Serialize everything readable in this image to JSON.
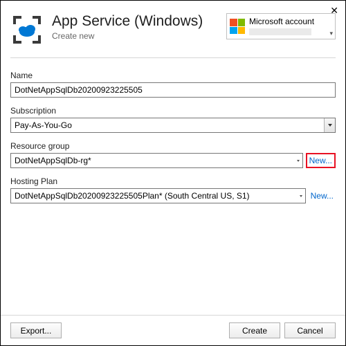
{
  "header": {
    "title": "App Service (Windows)",
    "subtitle": "Create new",
    "account_label": "Microsoft account"
  },
  "fields": {
    "name": {
      "label": "Name",
      "value": "DotNetAppSqlDb20200923225505"
    },
    "subscription": {
      "label": "Subscription",
      "value": "Pay-As-You-Go"
    },
    "resource_group": {
      "label": "Resource group",
      "value": "DotNetAppSqlDb-rg*",
      "new_label": "New..."
    },
    "hosting_plan": {
      "label": "Hosting Plan",
      "value": "DotNetAppSqlDb20200923225505Plan* (South Central US, S1)",
      "new_label": "New..."
    }
  },
  "footer": {
    "export": "Export...",
    "create": "Create",
    "cancel": "Cancel"
  }
}
